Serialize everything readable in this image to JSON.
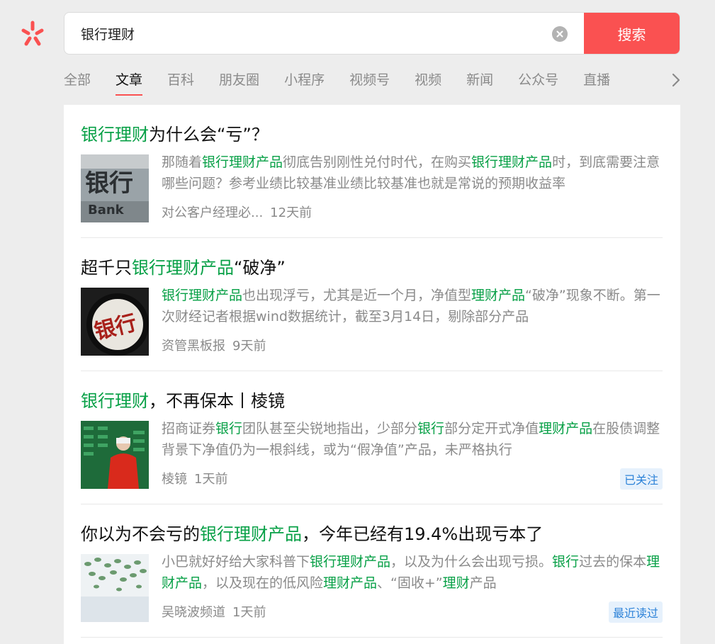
{
  "search": {
    "query": "银行理财",
    "button_label": "搜索"
  },
  "tabs": [
    {
      "label": "全部",
      "active": false
    },
    {
      "label": "文章",
      "active": true
    },
    {
      "label": "百科",
      "active": false
    },
    {
      "label": "朋友圈",
      "active": false
    },
    {
      "label": "小程序",
      "active": false
    },
    {
      "label": "视频号",
      "active": false
    },
    {
      "label": "视频",
      "active": false
    },
    {
      "label": "新闻",
      "active": false
    },
    {
      "label": "公众号",
      "active": false
    },
    {
      "label": "直播",
      "active": false
    }
  ],
  "colors": {
    "accent": "#fa5151",
    "highlight": "#07a046",
    "badge_text": "#2c82d8",
    "badge_bg": "#e6f1fc"
  },
  "results": [
    {
      "title": [
        {
          "text": "银行理财",
          "hl": true
        },
        {
          "text": "为什么会“亏”？",
          "hl": false
        }
      ],
      "snippet": [
        {
          "text": "那随着",
          "hl": false
        },
        {
          "text": "银行理财产品",
          "hl": true
        },
        {
          "text": "彻底告别刚性兑付时代，在购买",
          "hl": false
        },
        {
          "text": "银行理财产品",
          "hl": true
        },
        {
          "text": "时，到底需要注意哪些问题？参考业绩比较基准业绩比较基准也就是常说的预期收益率",
          "hl": false
        }
      ],
      "source": "对公客户经理必...",
      "time": "12天前",
      "badge": "",
      "thumb_icon": "bank-sign-image"
    },
    {
      "title": [
        {
          "text": "超千只",
          "hl": false
        },
        {
          "text": "银行理财产品",
          "hl": true
        },
        {
          "text": "“破净”",
          "hl": false
        }
      ],
      "snippet": [
        {
          "text": "银行理财产品",
          "hl": true
        },
        {
          "text": "也出现浮亏，尤其是近一个月，净值型",
          "hl": false
        },
        {
          "text": "理财产品",
          "hl": true
        },
        {
          "text": "“破净”现象不断。第一次财经记者根据wind数据统计，截至3月14日，剔除部分产品",
          "hl": false
        }
      ],
      "source": "资管黑板报",
      "time": "9天前",
      "badge": "",
      "thumb_icon": "bank-magnifier-image"
    },
    {
      "title": [
        {
          "text": "银行理财",
          "hl": true
        },
        {
          "text": "，不再保本丨棱镜",
          "hl": false
        }
      ],
      "snippet": [
        {
          "text": "招商证券",
          "hl": false
        },
        {
          "text": "银行",
          "hl": true
        },
        {
          "text": "团队甚至尖锐地指出，少部分",
          "hl": false
        },
        {
          "text": "银行",
          "hl": true
        },
        {
          "text": "部分定开式净值",
          "hl": false
        },
        {
          "text": "理财产品",
          "hl": true
        },
        {
          "text": "在股债调整背景下净值仍为一根斜线，或为“假净值”产品，未严格执行",
          "hl": false
        }
      ],
      "source": "棱镜",
      "time": "1天前",
      "badge": "已关注",
      "thumb_icon": "person-stock-board-image"
    },
    {
      "title": [
        {
          "text": "你以为不会亏的",
          "hl": false
        },
        {
          "text": "银行理财产品",
          "hl": true
        },
        {
          "text": "，今年已经有19.4%出现亏本了",
          "hl": false
        }
      ],
      "snippet": [
        {
          "text": "小巴就好好给大家科普下",
          "hl": false
        },
        {
          "text": "银行理财产品",
          "hl": true
        },
        {
          "text": "，以及为什么会出现亏损。",
          "hl": false
        },
        {
          "text": "银行",
          "hl": true
        },
        {
          "text": "过去的保本",
          "hl": false
        },
        {
          "text": "理财产品",
          "hl": true
        },
        {
          "text": "，以及现在的低风险",
          "hl": false
        },
        {
          "text": "理财产品",
          "hl": true
        },
        {
          "text": "、“固收+”",
          "hl": false
        },
        {
          "text": "理财",
          "hl": true
        },
        {
          "text": "产品",
          "hl": false
        }
      ],
      "source": "吴晓波频道",
      "time": "1天前",
      "badge": "最近读过",
      "thumb_icon": "money-leaves-image"
    }
  ]
}
